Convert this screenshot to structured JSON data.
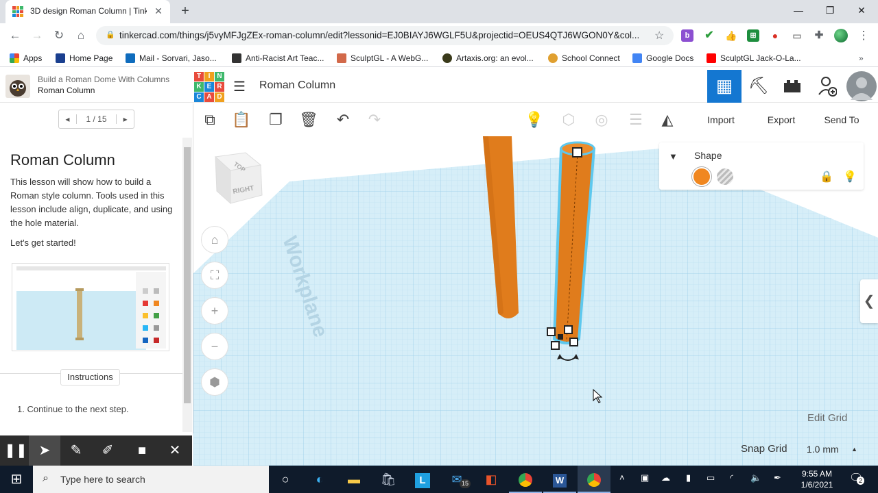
{
  "browser": {
    "tab_title": "3D design Roman Column | Tinkercad",
    "url": "tinkercad.com/things/j5vyMFJgZEx-roman-column/edit?lessonid=EJ0BIAYJ6WGLF5U&projectid=OEUS4QTJ6WGON0Y&col...",
    "extensions": [
      "b",
      "✔",
      "👍",
      "⊞",
      "●",
      "▭",
      "puzzle-icon"
    ],
    "bookmarks": [
      {
        "label": "Apps",
        "icon": "apps-grid-icon",
        "color": "#4285f4"
      },
      {
        "label": "Home Page",
        "icon": "tac-icon",
        "color": "#1a3f8f"
      },
      {
        "label": "Mail - Sorvari, Jaso...",
        "icon": "outlook-icon",
        "color": "#0f6cbd"
      },
      {
        "label": "Anti-Racist Art Teac...",
        "icon": "dark-square-icon",
        "color": "#333333"
      },
      {
        "label": "SculptGL - A WebG...",
        "icon": "sculptgl-icon",
        "color": "#d2694a"
      },
      {
        "label": "Artaxis.org: an evol...",
        "icon": "artaxis-icon",
        "color": "#3a3a1a"
      },
      {
        "label": "School Connect",
        "icon": "school-connect-icon",
        "color": "#e0a030"
      },
      {
        "label": "Google Docs",
        "icon": "docs-icon",
        "color": "#4285f4"
      },
      {
        "label": "SculptGL Jack-O-La...",
        "icon": "youtube-icon",
        "color": "#ff0000"
      }
    ]
  },
  "lesson": {
    "project": "Build a Roman Dome With Columns",
    "current": "Roman Column",
    "pager": "1 / 15",
    "heading": "Roman Column",
    "body": "This lesson will show how to build a Roman style column. Tools used in this lesson include align, duplicate, and using the hole material.",
    "cta": "Let's get started!",
    "instructions_tab": "Instructions",
    "step": "1. Continue to the next step."
  },
  "header": {
    "logo_letters": [
      "T",
      "I",
      "N",
      "K",
      "E",
      "R",
      "C",
      "A",
      "D"
    ],
    "logo_colors": [
      "#e84b3c",
      "#f0a01e",
      "#3eb86b",
      "#3eb86b",
      "#1a87d9",
      "#e84b3c",
      "#1a87d9",
      "#e84b3c",
      "#f0a01e"
    ],
    "design_name": "Roman Column"
  },
  "edit_toolbar": {
    "import": "Import",
    "export": "Export",
    "send_to": "Send To"
  },
  "viewcube": {
    "top": "TOP",
    "right": "RIGHT"
  },
  "workplane_label": "Workplane",
  "shape_panel": {
    "title": "Shape",
    "solid_color": "#f08720"
  },
  "grid": {
    "edit_grid": "Edit Grid",
    "snap_label": "Snap Grid",
    "snap_value": "1.0 mm"
  },
  "colors": {
    "accent": "#1477d1",
    "workplane": "#d3ecf7",
    "cylinder": "#e07c1c",
    "selection": "#5ec8ee"
  },
  "taskbar": {
    "search_placeholder": "Type here to search",
    "mail_badge": "15",
    "time": "9:55 AM",
    "date": "1/6/2021",
    "notifications": "2"
  }
}
